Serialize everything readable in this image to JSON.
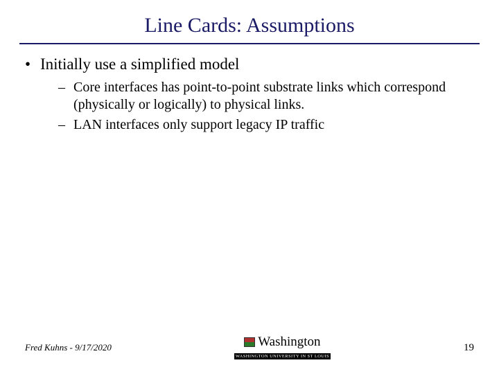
{
  "title": "Line Cards: Assumptions",
  "bullets": {
    "l1": "Initially use a simplified model",
    "l2a": "Core interfaces has point-to-point substrate links which correspond (physically or logically) to physical links.",
    "l2b": "LAN interfaces only support legacy IP traffic"
  },
  "footer": {
    "left": "Fred Kuhns - 9/17/2020",
    "uni": "Washington",
    "sub": "WASHINGTON UNIVERSITY IN ST LOUIS",
    "page": "19"
  }
}
